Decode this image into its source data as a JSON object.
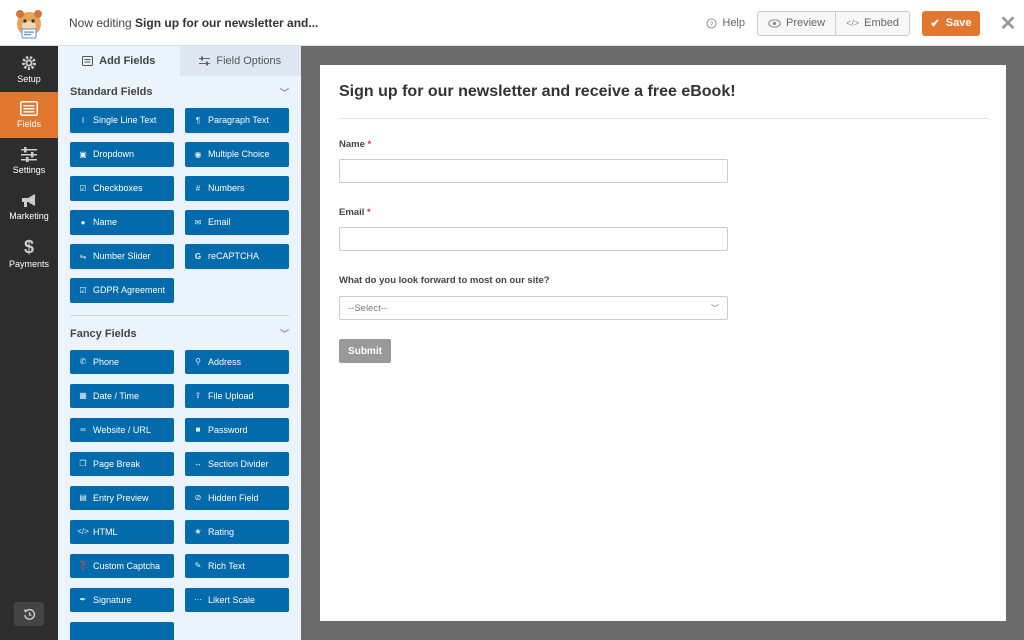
{
  "topbar": {
    "editing_prefix": "Now editing",
    "editing_title": "Sign up for our newsletter and...",
    "help_label": "Help",
    "preview_label": "Preview",
    "embed_label": "Embed",
    "save_label": "Save"
  },
  "leftnav": {
    "items": [
      {
        "label": "Setup",
        "icon": "gear-icon"
      },
      {
        "label": "Fields",
        "icon": "fields-list-icon",
        "active": true
      },
      {
        "label": "Settings",
        "icon": "sliders-icon"
      },
      {
        "label": "Marketing",
        "icon": "megaphone-icon"
      },
      {
        "label": "Payments",
        "icon": "dollar-icon"
      }
    ]
  },
  "panel": {
    "tabs": {
      "add_fields": "Add Fields",
      "field_options": "Field Options"
    },
    "standard": {
      "title": "Standard Fields",
      "fields": [
        "Single Line Text",
        "Paragraph Text",
        "Dropdown",
        "Multiple Choice",
        "Checkboxes",
        "Numbers",
        "Name",
        "Email",
        "Number Slider",
        "reCAPTCHA",
        "GDPR Agreement"
      ]
    },
    "fancy": {
      "title": "Fancy Fields",
      "fields": [
        "Phone",
        "Address",
        "Date / Time",
        "File Upload",
        "Website / URL",
        "Password",
        "Page Break",
        "Section Divider",
        "Entry Preview",
        "Hidden Field",
        "HTML",
        "Rating",
        "Custom Captcha",
        "Rich Text",
        "Signature",
        "Likert Scale"
      ]
    }
  },
  "form": {
    "title": "Sign up for our newsletter and receive a free eBook!",
    "name_label": "Name",
    "email_label": "Email",
    "required_mark": "*",
    "question_label": "What do you look forward to most on our site?",
    "select_placeholder": "--Select--",
    "submit_label": "Submit"
  },
  "colors": {
    "accent": "#e27730",
    "field_button": "#036aab",
    "nav_bg": "#2d2d2d",
    "panel_bg": "#ebf3fc"
  }
}
